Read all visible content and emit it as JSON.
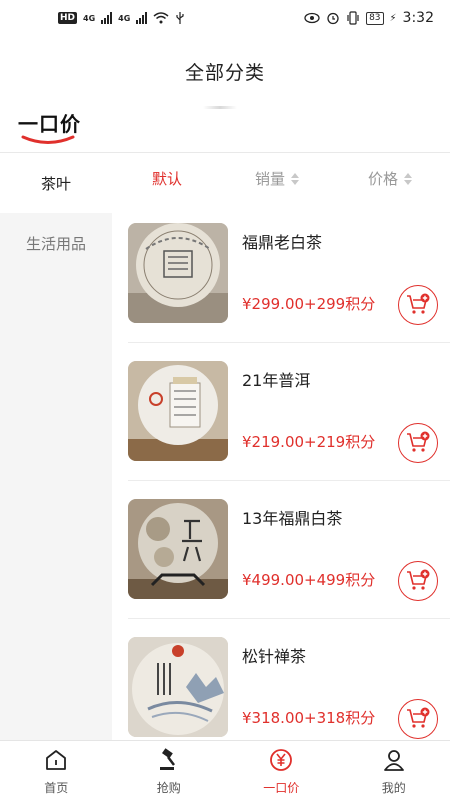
{
  "status_bar": {
    "hd": "HD",
    "net1": "4G",
    "net2": "4G",
    "battery": "83",
    "time": "3:32"
  },
  "header": {
    "title": "全部分类"
  },
  "brand": {
    "text": "一口价"
  },
  "sidebar": {
    "items": [
      {
        "label": "茶叶",
        "active": true
      },
      {
        "label": "生活用品",
        "active": false
      }
    ]
  },
  "sort": {
    "items": [
      {
        "label": "默认"
      },
      {
        "label": "销量"
      },
      {
        "label": "价格"
      }
    ]
  },
  "products": [
    {
      "name": "福鼎老白茶",
      "price": "¥299.00+299积分"
    },
    {
      "name": "21年普洱",
      "price": "¥219.00+219积分"
    },
    {
      "name": "13年福鼎白茶",
      "price": "¥499.00+499积分"
    },
    {
      "name": "松针禅茶",
      "price": "¥318.00+318积分"
    }
  ],
  "tabs": [
    {
      "label": "首页",
      "icon": "home-icon"
    },
    {
      "label": "抢购",
      "icon": "auction-hammer-icon"
    },
    {
      "label": "一口价",
      "icon": "yen-icon",
      "active": true
    },
    {
      "label": "我的",
      "icon": "user-icon"
    }
  ],
  "colors": {
    "accent": "#e0302c"
  }
}
